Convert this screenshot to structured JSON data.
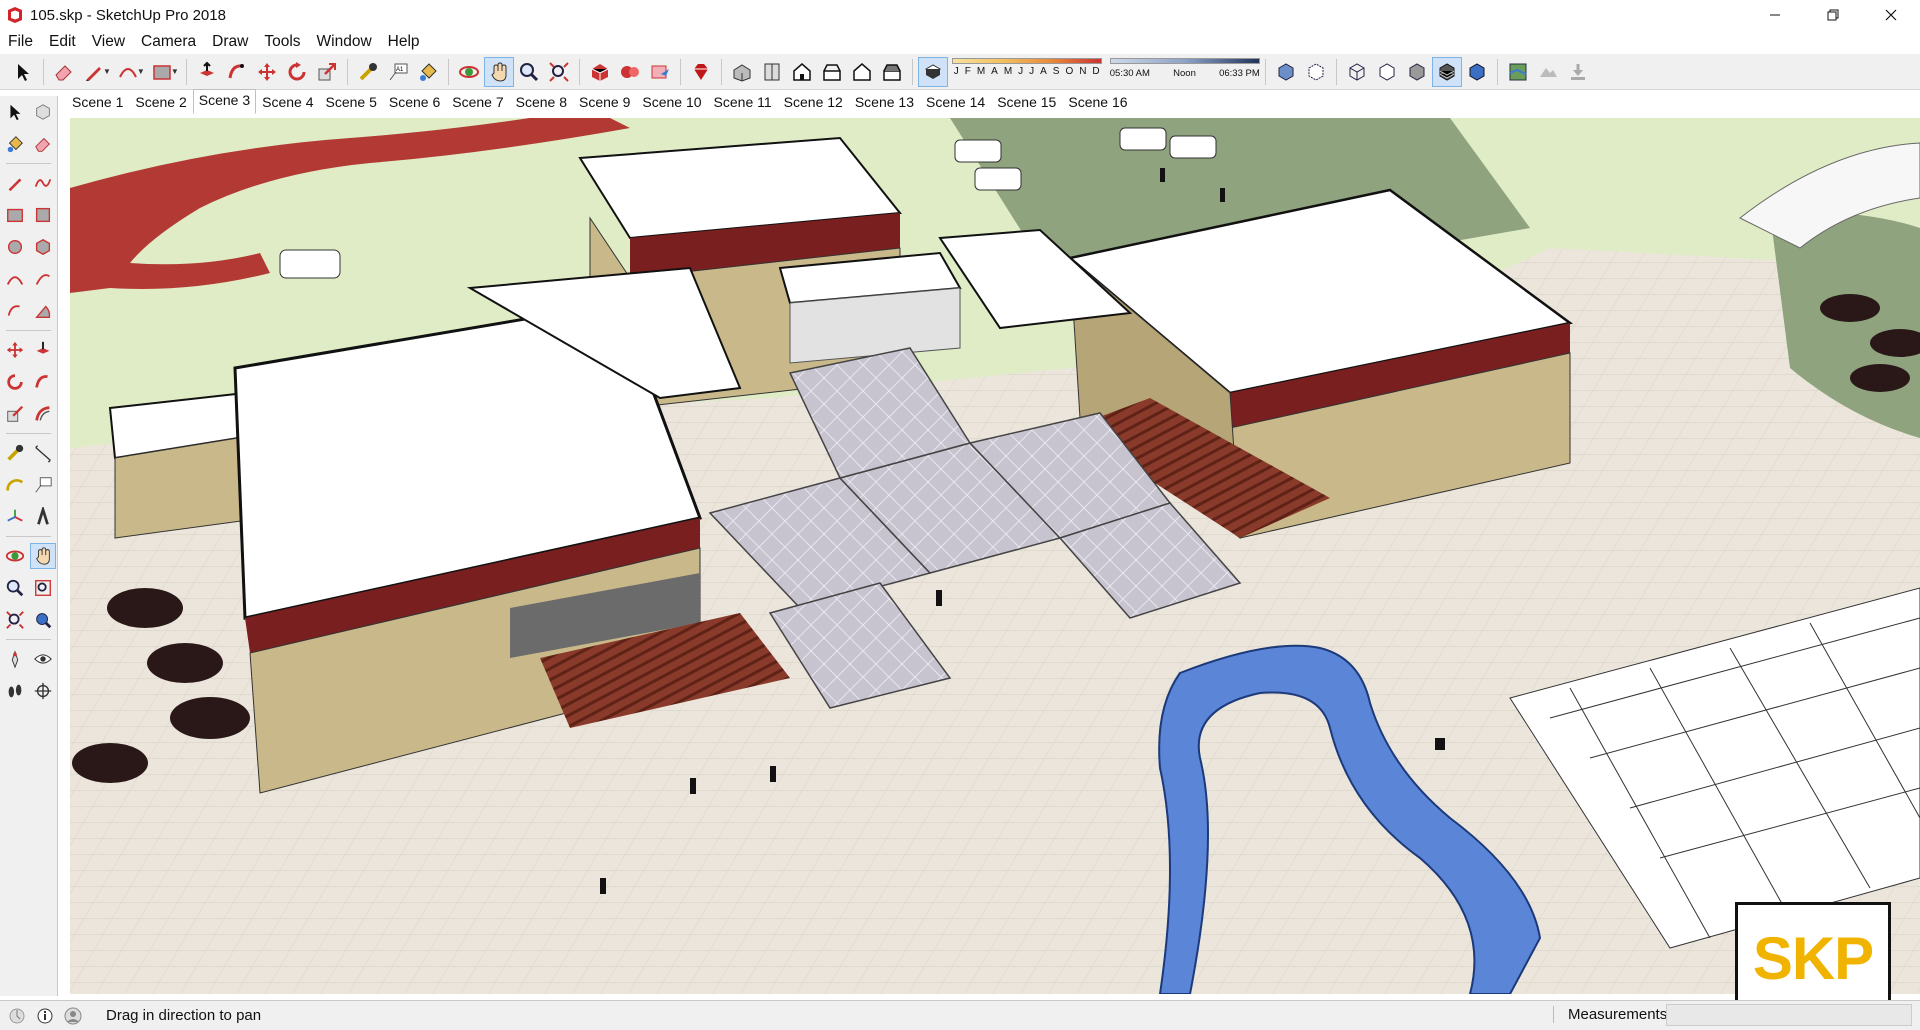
{
  "window": {
    "title": "105.skp - SketchUp Pro 2018",
    "controls": [
      "minimize",
      "restore",
      "close"
    ]
  },
  "menubar": {
    "items": [
      "File",
      "Edit",
      "View",
      "Camera",
      "Draw",
      "Tools",
      "Window",
      "Help"
    ]
  },
  "shadows": {
    "months": [
      "J",
      "F",
      "M",
      "A",
      "M",
      "J",
      "J",
      "A",
      "S",
      "O",
      "N",
      "D"
    ],
    "time_start": "05:30 AM",
    "time_mid": "Noon",
    "time_end": "06:33 PM"
  },
  "scenes": {
    "tabs": [
      "Scene 1",
      "Scene 2",
      "Scene 3",
      "Scene 4",
      "Scene 5",
      "Scene 6",
      "Scene 7",
      "Scene 8",
      "Scene 9",
      "Scene 10",
      "Scene 11",
      "Scene 12",
      "Scene 13",
      "Scene 14",
      "Scene 15",
      "Scene 16"
    ],
    "selected_index": 2
  },
  "toolbar": {
    "active_tool": "pan-icon"
  },
  "statusbar": {
    "message": "Drag in direction to pan",
    "measurements_label": "Measurements",
    "measurements_value": ""
  },
  "watermark": {
    "text": "SKP"
  },
  "colors": {
    "accent_blue": "#7eb3e6",
    "roof": "#ffffff",
    "wall": "#c9b98a",
    "trim": "#7a1f1f",
    "lawn": "#dfecc6",
    "water": "#5b85d6",
    "watermark": "#f0b400"
  }
}
